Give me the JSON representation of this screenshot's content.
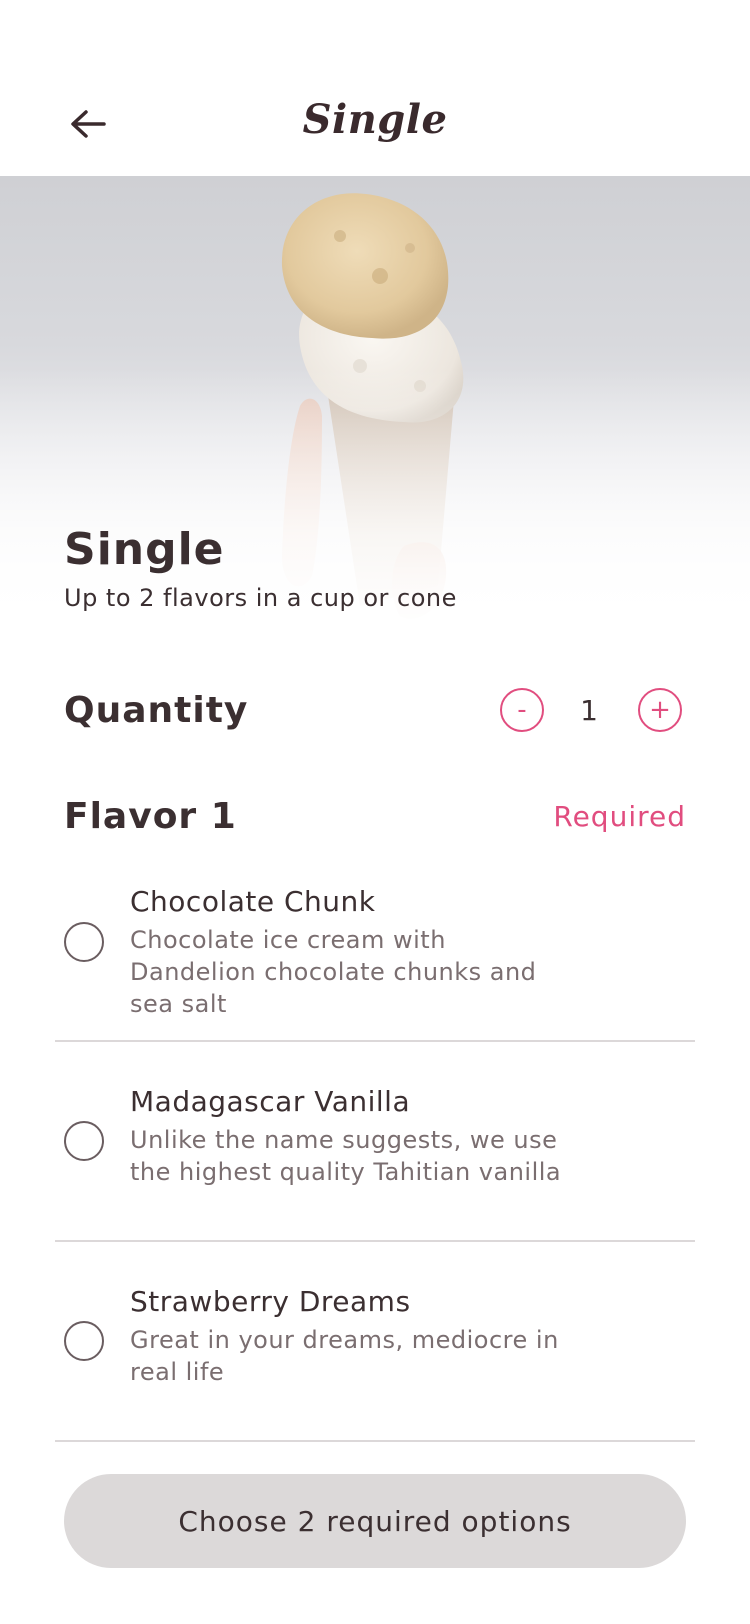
{
  "header": {
    "title": "Single",
    "back_icon": "arrow-left-icon"
  },
  "hero": {
    "image": "ice-cream-cone-photo",
    "title": "Single",
    "subtitle": "Up to 2 flavors in a cup or cone"
  },
  "quantity": {
    "label": "Quantity",
    "minus_label": "-",
    "value": "1",
    "plus_label": "+"
  },
  "flavor": {
    "title": "Flavor 1",
    "required_label": "Required",
    "options": [
      {
        "name": "Chocolate Chunk",
        "description": "Chocolate ice cream with Dandelion chocolate chunks and sea salt"
      },
      {
        "name": "Madagascar Vanilla",
        "description": "Unlike the name suggests, we use the highest quality Tahitian vanilla"
      },
      {
        "name": "Strawberry Dreams",
        "description": "Great in your dreams, mediocre in real life"
      }
    ]
  },
  "cta": {
    "label": "Choose 2 required options"
  },
  "colors": {
    "accent": "#e14d7f",
    "text": "#3b2f31",
    "muted_text": "#7a6e70",
    "divider": "#dcd8d9",
    "button_disabled": "#dcd9d9"
  }
}
